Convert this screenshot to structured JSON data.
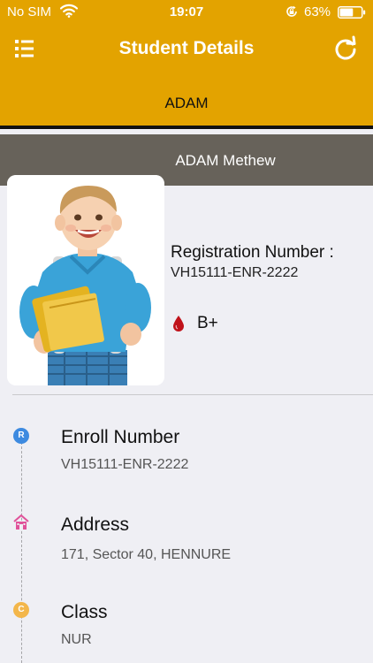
{
  "status_bar": {
    "carrier": "No SIM",
    "time": "19:07",
    "battery_percent": "63%",
    "battery_level": 0.63,
    "icons": [
      "wifi-icon",
      "orientation-lock-icon",
      "battery-icon"
    ]
  },
  "nav": {
    "title": "Student Details",
    "left_icon": "list-menu-icon",
    "right_icon": "refresh-icon"
  },
  "student_tab": {
    "label": "ADAM"
  },
  "student": {
    "full_name": "ADAM Methew",
    "registration_label": "Registration Number :",
    "registration_number": "VH15111-ENR-2222",
    "blood_group": "B+",
    "blood_icon": "blood-drop-icon"
  },
  "details": [
    {
      "icon_letter": "R",
      "icon_color": "#3d8ae0",
      "label": "Enroll Number",
      "value": "VH15111-ENR-2222"
    },
    {
      "icon": "house-icon",
      "icon_color": "#e0529a",
      "label": "Address",
      "value": "171, Sector 40, HENNURE"
    },
    {
      "icon_letter": "C",
      "icon_color": "#f3b64a",
      "label": "Class",
      "value": "NUR"
    }
  ],
  "colors": {
    "header": "#e3a300",
    "name_bar": "#67625a",
    "background": "#efeff4",
    "blood_drop": "#c0121a"
  }
}
